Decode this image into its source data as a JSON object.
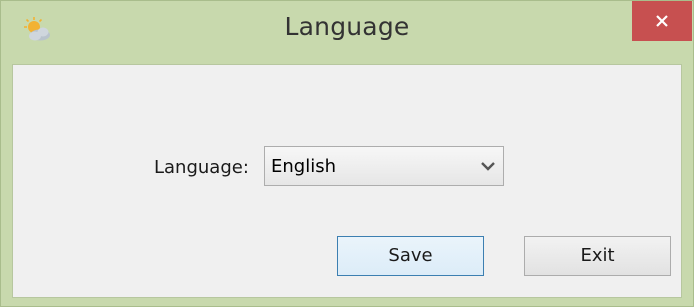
{
  "window": {
    "title": "Language",
    "app_icon": "weather-icon",
    "close_icon": "close-icon",
    "colors": {
      "frame": "#c8d9ad",
      "close_button": "#c75050",
      "content_background": "#f0f0f0",
      "default_button_border": "#3c7fb1"
    }
  },
  "form": {
    "language_label": "Language:",
    "language_selected": "English"
  },
  "buttons": {
    "save_label": "Save",
    "exit_label": "Exit"
  }
}
